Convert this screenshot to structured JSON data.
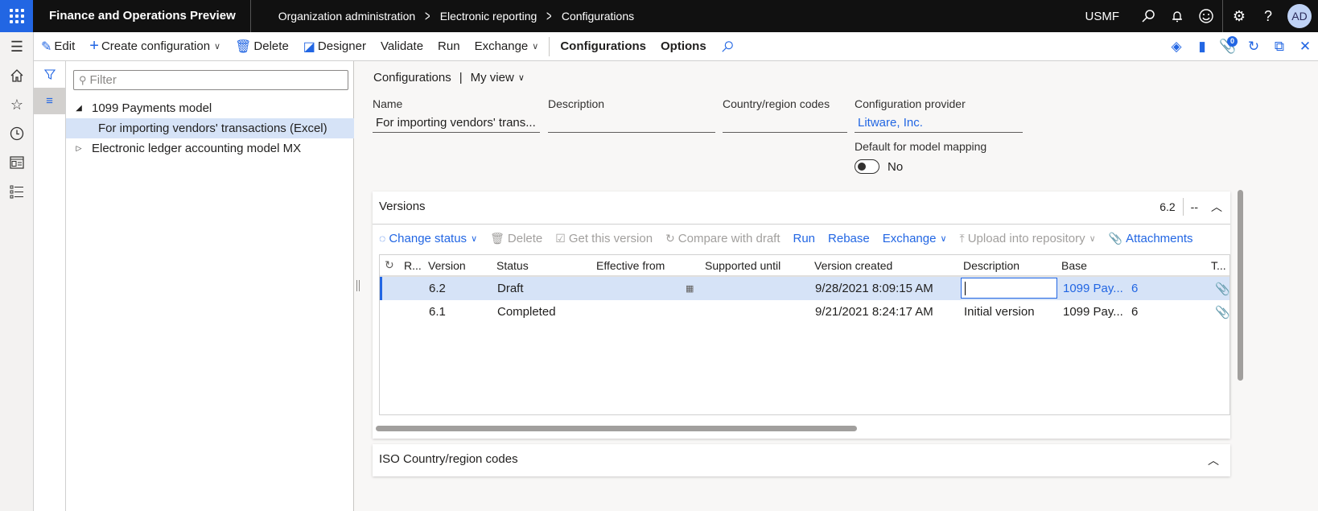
{
  "topbar": {
    "app_title": "Finance and Operations Preview",
    "breadcrumb": [
      "Organization administration",
      "Electronic reporting",
      "Configurations"
    ],
    "company": "USMF",
    "icons": [
      "search-icon",
      "bell-icon",
      "smiley-icon",
      "gear-icon",
      "help-icon"
    ],
    "avatar_initials": "AD"
  },
  "actionbar": {
    "edit": "Edit",
    "create_configuration": "Create configuration",
    "delete": "Delete",
    "designer": "Designer",
    "validate": "Validate",
    "run": "Run",
    "exchange": "Exchange",
    "configurations": "Configurations",
    "options": "Options",
    "attachments_count": "0"
  },
  "tree": {
    "filter_placeholder": "Filter",
    "nodes": [
      {
        "label": "1099 Payments model",
        "expanded": true,
        "level": 0
      },
      {
        "label": "For importing vendors' transactions (Excel)",
        "selected": true,
        "level": 1
      },
      {
        "label": "Electronic ledger accounting model MX",
        "expanded": false,
        "level": 0
      }
    ]
  },
  "main": {
    "view_title": "Configurations",
    "view_name": "My view",
    "fields": {
      "name_label": "Name",
      "name_value": "For importing vendors' trans...",
      "description_label": "Description",
      "description_value": "",
      "country_label": "Country/region codes",
      "country_value": "",
      "provider_label": "Configuration provider",
      "provider_value": "Litware, Inc.",
      "default_mapping_label": "Default for model mapping",
      "default_mapping_value": "No"
    }
  },
  "versions": {
    "title": "Versions",
    "summary_version": "6.2",
    "summary_status": "--",
    "toolbar": {
      "change_status": "Change status",
      "delete": "Delete",
      "get_this_version": "Get this version",
      "compare_with_draft": "Compare with draft",
      "run": "Run",
      "rebase": "Rebase",
      "exchange": "Exchange",
      "upload_into_repository": "Upload into repository",
      "attachments": "Attachments"
    },
    "columns": [
      "R...",
      "Version",
      "Status",
      "Effective from",
      "Supported until",
      "Version created",
      "Description",
      "Base",
      "",
      "T..."
    ],
    "rows": [
      {
        "version": "6.2",
        "status": "Draft",
        "effective_from": "",
        "supported_until": "",
        "created": "9/28/2021 8:09:15 AM",
        "description": "",
        "base": "1099 Pay...",
        "base_version": "6",
        "selected": true
      },
      {
        "version": "6.1",
        "status": "Completed",
        "effective_from": "",
        "supported_until": "",
        "created": "9/21/2021 8:24:17 AM",
        "description": "Initial version",
        "base": "1099 Pay...",
        "base_version": "6",
        "selected": false
      }
    ]
  },
  "iso_section": {
    "title": "ISO Country/region codes"
  }
}
